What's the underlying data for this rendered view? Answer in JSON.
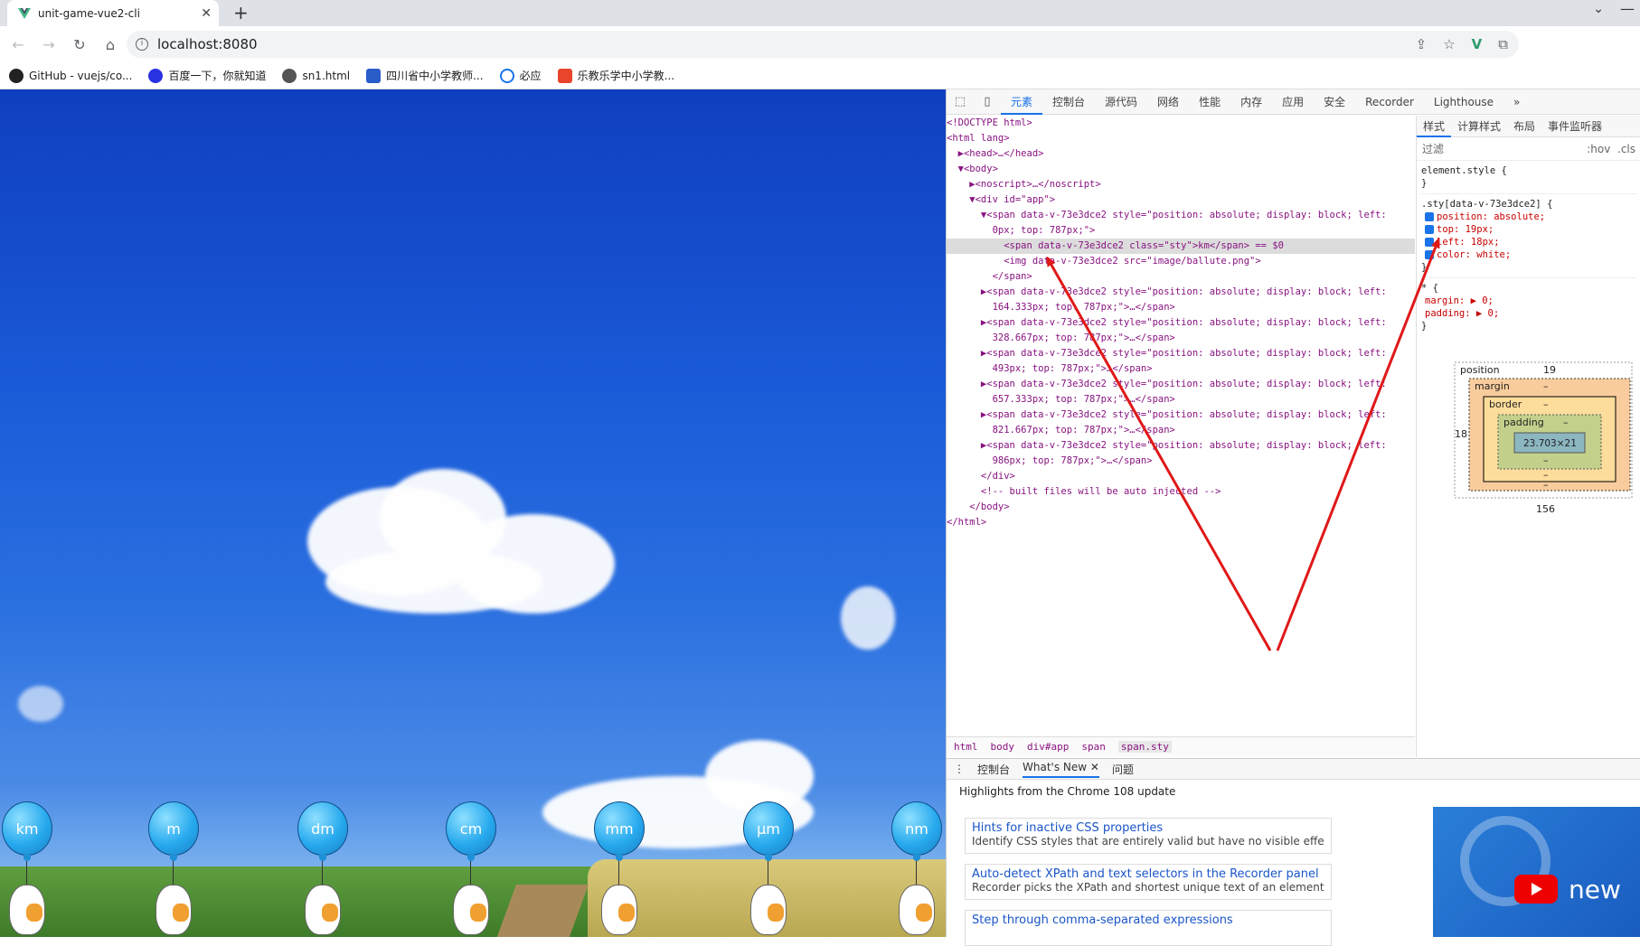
{
  "browser": {
    "tab_title": "unit-game-vue2-cli",
    "url": "localhost:8080",
    "bookmarks": [
      "GitHub - vuejs/co...",
      "百度一下，你就知道",
      "sn1.html",
      "四川省中小学教师...",
      "必应",
      "乐教乐学中小学教..."
    ]
  },
  "game": {
    "balloons": [
      "km",
      "m",
      "dm",
      "cm",
      "mm",
      "μm",
      "nm"
    ]
  },
  "devtools": {
    "tabs": [
      "元素",
      "控制台",
      "源代码",
      "网络",
      "性能",
      "内存",
      "应用",
      "安全",
      "Recorder",
      "Lighthouse"
    ],
    "elements_lines": [
      "<!DOCTYPE html>",
      "<html lang>",
      "  ▶<head>…</head>",
      "  ▼<body>",
      "    ▶<noscript>…</noscript>",
      "    ▼<div id=\"app\">",
      "      ▼<span data-v-73e3dce2 style=\"position: absolute; display: block; left:",
      "        0px; top: 787px;\">",
      "          <span data-v-73e3dce2 class=\"sty\">km</span> == $0",
      "          <img data-v-73e3dce2 src=\"image/ballute.png\">",
      "        </span>",
      "      ▶<span data-v-73e3dce2 style=\"position: absolute; display: block; left:",
      "        164.333px; top: 787px;\">…</span>",
      "      ▶<span data-v-73e3dce2 style=\"position: absolute; display: block; left:",
      "        328.667px; top: 787px;\">…</span>",
      "      ▶<span data-v-73e3dce2 style=\"position: absolute; display: block; left:",
      "        493px; top: 787px;\">…</span>",
      "      ▶<span data-v-73e3dce2 style=\"position: absolute; display: block; left:",
      "        657.333px; top: 787px;\">…</span>",
      "      ▶<span data-v-73e3dce2 style=\"position: absolute; display: block; left:",
      "        821.667px; top: 787px;\">…</span>",
      "      ▶<span data-v-73e3dce2 style=\"position: absolute; display: block; left:",
      "        986px; top: 787px;\">…</span>",
      "      </div>",
      "      <!-- built files will be auto injected -->",
      "    </body>",
      "</html>"
    ],
    "styles_tabs": [
      "样式",
      "计算样式",
      "布局",
      "事件监听器"
    ],
    "filter_placeholder": "过滤",
    "filter_hov": ":hov",
    "filter_cls": ".cls",
    "rule1_selector": "element.style {",
    "rule2_selector": ".sty[data-v-73e3dce2] {",
    "rule2_props": [
      "position: absolute;",
      "top: 19px;",
      "left: 18px;",
      "color: white;"
    ],
    "rule3_selector": "* {",
    "rule3_props": [
      "margin: ▶ 0;",
      "padding: ▶ 0;"
    ],
    "box_model": {
      "position_label": "position",
      "position_top": "19",
      "position_left": "18",
      "position_bottom": "156",
      "margin_label": "margin",
      "border_label": "border",
      "padding_label": "padding",
      "content_size": "23.703×21",
      "dash": "–"
    },
    "breadcrumb": [
      "html",
      "body",
      "div#app",
      "span",
      "span.sty"
    ],
    "drawer_tabs": [
      "控制台",
      "What's New",
      "问题"
    ],
    "highlights_title": "Highlights from the Chrome 108 update",
    "cards": [
      {
        "title": "Hints for inactive CSS properties",
        "desc": "Identify CSS styles that are entirely valid but have no visible effect."
      },
      {
        "title": "Auto-detect XPath and text selectors in the Recorder panel",
        "desc": "Recorder picks the XPath and shortest unique text of an element as its selector."
      },
      {
        "title": "Step through comma-separated expressions",
        "desc": ""
      }
    ],
    "video_text": "new"
  }
}
